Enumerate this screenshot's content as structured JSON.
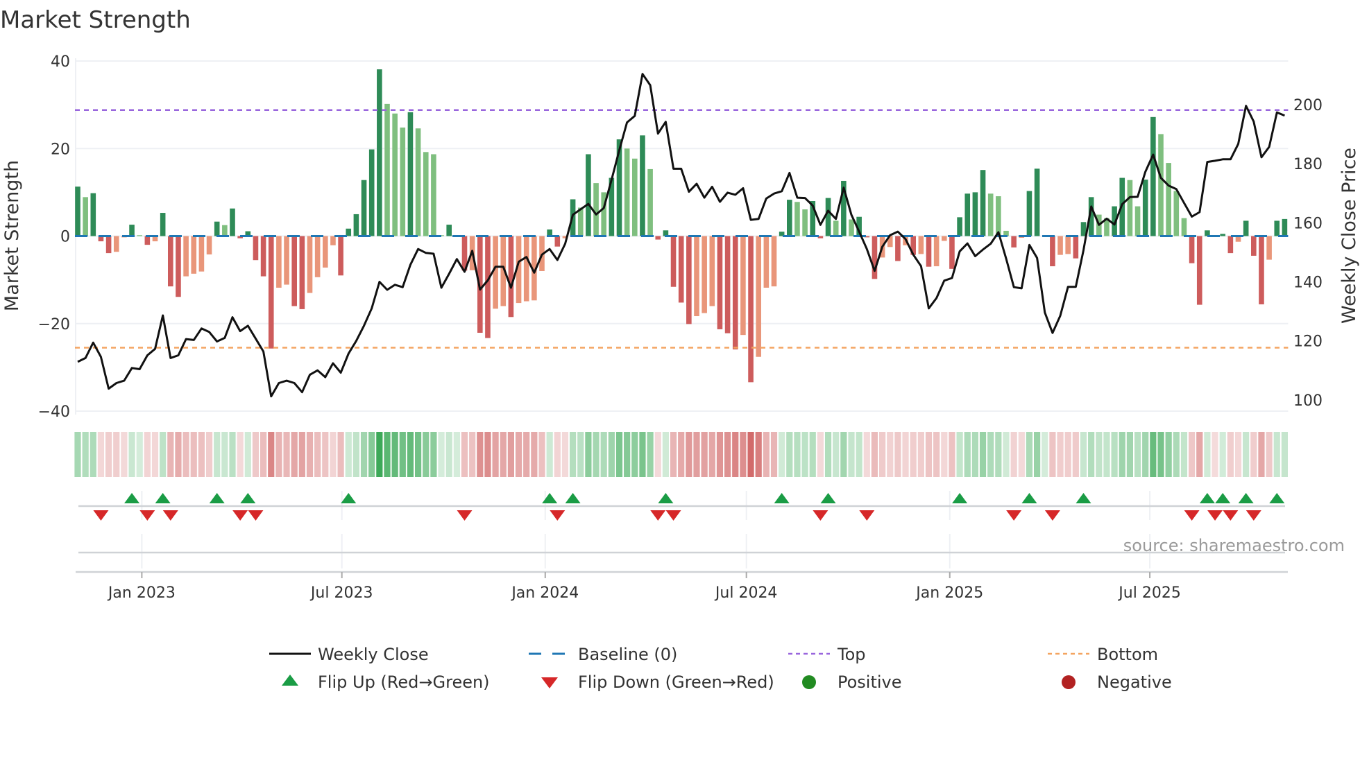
{
  "chart_data": {
    "type": "bar",
    "title": "Market Strength",
    "ylabel": "Market Strength",
    "y2label": "Weekly Close Price",
    "ylim": [
      -40,
      40
    ],
    "y_ticks": [
      40,
      20,
      0,
      -20,
      -40
    ],
    "y_tick_labels": [
      "40",
      "20",
      "0",
      "−20",
      "−40"
    ],
    "y2lim": [
      96.2,
      214.8
    ],
    "y2_ticks": [
      200,
      180,
      160,
      140,
      120,
      100
    ],
    "y2_tick_labels": [
      "200",
      "180",
      "160",
      "140",
      "120",
      "100"
    ],
    "x_start": "2022-11-04",
    "x_frequency": "weekly",
    "x_ticks": [
      {
        "date": "2023-01-01",
        "label": "Jan 2023"
      },
      {
        "date": "2023-07-01",
        "label": "Jul 2023"
      },
      {
        "date": "2024-01-01",
        "label": "Jan 2024"
      },
      {
        "date": "2024-07-01",
        "label": "Jul 2024"
      },
      {
        "date": "2025-01-01",
        "label": "Jan 2025"
      },
      {
        "date": "2025-07-01",
        "label": "Jul 2025"
      }
    ],
    "top_level": 28.8,
    "bottom_level": -25.5,
    "baseline": 0,
    "series": [
      {
        "name": "Market Strength",
        "kind": "bar",
        "values": [
          11.3,
          8.9,
          9.8,
          -1.2,
          -3.9,
          -3.6,
          -0.3,
          2.6,
          0.2,
          -2.0,
          -1.2,
          5.3,
          -11.5,
          -13.9,
          -9.2,
          -8.6,
          -8.1,
          -4.2,
          3.3,
          2.5,
          6.3,
          -0.5,
          1.1,
          -5.5,
          -9.2,
          -25.7,
          -11.8,
          -11.1,
          -16.0,
          -16.7,
          -13.0,
          -9.4,
          -7.2,
          -2.1,
          -9.0,
          1.7,
          5.0,
          12.8,
          19.8,
          38.1,
          30.2,
          28.0,
          24.8,
          28.3,
          24.6,
          19.2,
          18.7,
          0.2,
          2.6,
          0.1,
          -7.9,
          -7.8,
          -22.1,
          -23.3,
          -16.6,
          -16.0,
          -18.5,
          -15.3,
          -14.9,
          -14.7,
          -8.0,
          1.5,
          -2.4,
          -0.5,
          8.4,
          6.5,
          18.7,
          12.1,
          10.0,
          13.3,
          22.1,
          20.0,
          17.7,
          23.0,
          15.3,
          -0.8,
          1.3,
          -11.6,
          -15.2,
          -20.1,
          -18.3,
          -17.6,
          -16.0,
          -21.3,
          -22.2,
          -25.9,
          -22.6,
          -33.4,
          -27.6,
          -11.8,
          -11.5,
          1.0,
          8.3,
          7.8,
          6.1,
          8.0,
          -0.5,
          8.7,
          3.5,
          12.6,
          3.8,
          4.4,
          -0.3,
          -9.8,
          -4.9,
          -2.5,
          -5.7,
          -2.1,
          -4.3,
          -4.1,
          -7.0,
          -6.9,
          -1.1,
          -7.5,
          4.3,
          9.7,
          10.0,
          15.1,
          9.7,
          9.1,
          1.2,
          -2.6,
          -0.4,
          10.3,
          15.4,
          0.1,
          -6.9,
          -4.3,
          -4.1,
          -5.1,
          3.2,
          8.9,
          4.9,
          4.1,
          6.8,
          13.3,
          12.8,
          6.8,
          12.9,
          27.2,
          23.3,
          16.7,
          10.3,
          4.1,
          -6.2,
          -15.7,
          1.3,
          -0.2,
          0.5,
          -3.9,
          -1.3,
          3.5,
          -4.5,
          -15.6,
          -5.4,
          3.5,
          3.9
        ]
      },
      {
        "name": "Weekly Close",
        "kind": "line",
        "axis": "y2",
        "values": [
          112.9,
          114.2,
          119.4,
          114.6,
          103.8,
          105.7,
          106.5,
          110.8,
          110.4,
          115.1,
          117.3,
          128.6,
          114.2,
          115.1,
          120.6,
          120.3,
          124.2,
          123.0,
          119.8,
          121.0,
          128.0,
          123.3,
          125.1,
          120.8,
          116.4,
          101.2,
          105.7,
          106.5,
          105.7,
          102.6,
          108.5,
          110.0,
          107.7,
          112.4,
          109.2,
          115.7,
          120.0,
          125.1,
          131.0,
          140.0,
          137.3,
          139.0,
          138.2,
          145.8,
          151.1,
          149.8,
          149.5,
          138.0,
          142.7,
          147.7,
          143.4,
          150.5,
          137.4,
          140.5,
          145.1,
          145.1,
          138.0,
          146.8,
          148.4,
          143.1,
          149.2,
          151.1,
          147.4,
          152.9,
          162.7,
          164.6,
          166.4,
          162.8,
          165.0,
          174.6,
          184.6,
          194.0,
          196.2,
          210.4,
          206.6,
          190.2,
          194.2,
          178.3,
          178.3,
          170.5,
          173.2,
          168.5,
          172.2,
          167.1,
          170.2,
          169.5,
          171.7,
          161.0,
          161.3,
          168.2,
          169.9,
          170.7,
          176.9,
          168.5,
          168.4,
          165.8,
          159.3,
          164.1,
          161.3,
          171.9,
          162.7,
          157.0,
          151.1,
          143.7,
          151.9,
          155.8,
          157.0,
          154.5,
          149.2,
          145.3,
          131.0,
          134.5,
          140.4,
          141.3,
          150.3,
          153.0,
          148.7,
          150.9,
          152.9,
          156.8,
          147.9,
          138.2,
          137.8,
          152.5,
          148.1,
          129.6,
          122.7,
          128.5,
          138.3,
          138.3,
          150.7,
          165.5,
          159.3,
          161.4,
          159.4,
          166.3,
          168.7,
          168.8,
          177.3,
          183.1,
          175.2,
          172.6,
          171.4,
          166.7,
          162.1,
          163.6,
          180.6,
          181.0,
          181.5,
          181.5,
          186.7,
          199.6,
          194.3,
          182.2,
          185.7,
          197.4,
          196.3
        ]
      }
    ],
    "legend": {
      "placement": "bottom",
      "entries": [
        {
          "label": "Weekly Close",
          "symbol": "line-solid",
          "color": "#111111"
        },
        {
          "label": "Baseline (0)",
          "symbol": "line-dash",
          "color": "#1f77b4"
        },
        {
          "label": "Top",
          "symbol": "line-dot",
          "color": "#9966dd"
        },
        {
          "label": "Bottom",
          "symbol": "line-dot",
          "color": "#f4a460"
        },
        {
          "label": "Flip Up (Red→Green)",
          "symbol": "triangle-up",
          "color": "#1a9c45"
        },
        {
          "label": "Flip Down (Green→Red)",
          "symbol": "triangle-down",
          "color": "#d62728"
        },
        {
          "label": "Positive",
          "symbol": "circle",
          "color": "#228b22"
        },
        {
          "label": "Negative",
          "symbol": "circle",
          "color": "#b22222"
        }
      ]
    },
    "colors": {
      "pos_strong": "#2e8b57",
      "pos_weak": "#7fbf7f",
      "neg_strong": "#cd5c5c",
      "neg_weak": "#e9967a",
      "strip_pos": "#28a046",
      "strip_neg": "#c84b4b",
      "line": "#111111"
    },
    "source": "source: sharemaestro.com"
  }
}
